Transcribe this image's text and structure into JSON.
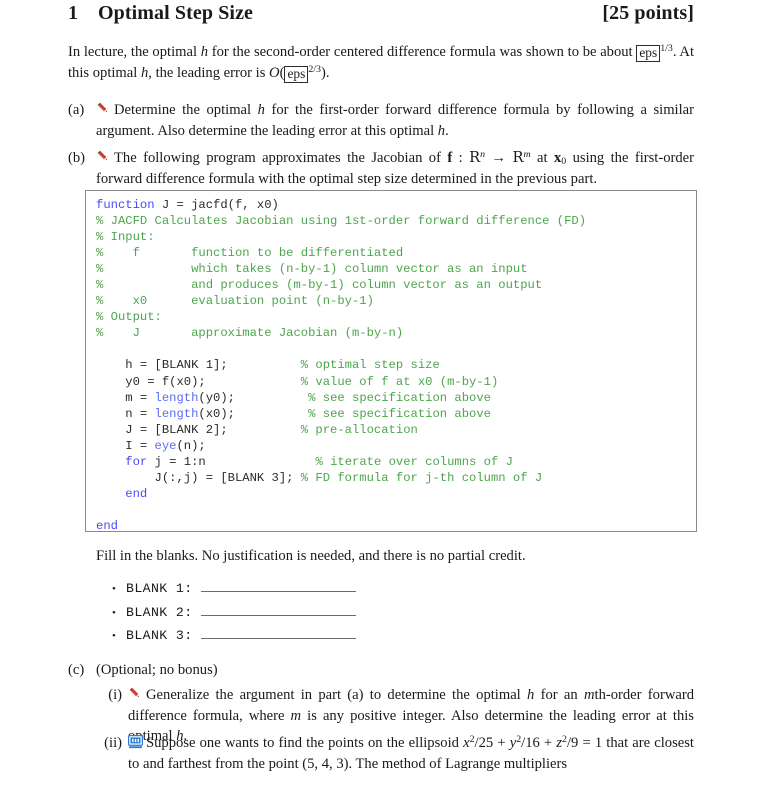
{
  "heading": {
    "number": "1",
    "title": "Optimal Step Size",
    "points": "[25 points]"
  },
  "intro": {
    "text_1": "In lecture, the optimal ",
    "var_h": "h",
    "text_2": " for the second-order centered difference formula was shown to be about ",
    "eps_1": "eps",
    "exp_1": "1/3",
    "text_3": ". At this optimal ",
    "var_h2": "h",
    "text_4": ", the leading error is ",
    "bigO": "O",
    "eps_2": "eps",
    "exp_2": "2/3",
    "text_5": ")."
  },
  "parts": {
    "a": {
      "label": "(a)",
      "icon": "pencil-icon",
      "text_1": "Determine the optimal ",
      "var_h": "h",
      "text_2": " for the first-order forward difference formula by following a similar argument. Also determine the leading error at this optimal ",
      "var_h2": "h",
      "text_3": "."
    },
    "b": {
      "label": "(b)",
      "icon": "pencil-icon",
      "text_1": "The following program approximates the Jacobian of ",
      "f_bold": "f",
      "colon": " : ",
      "Rn": "R",
      "Rn_sup": "n",
      "arrow": " → ",
      "Rm": "R",
      "Rm_sup": "m",
      "text_2": " at ",
      "x_bold": "x",
      "x_sub": "0",
      "text_3": " using the first-order forward difference formula with the optimal step size determined in the previous part."
    },
    "c": {
      "label": "(c)",
      "text": "(Optional; no bonus)",
      "sub_i": {
        "label": "(i)",
        "icon": "pencil-icon",
        "text_1": "Generalize the argument in part (a) to determine the optimal ",
        "var_h": "h",
        "text_2": " for an ",
        "var_m": "m",
        "text_3": "th-order forward difference formula, where ",
        "var_m2": "m",
        "text_4": " is any positive integer. Also determine the leading error at this optimal ",
        "var_h2": "h",
        "text_5": "."
      },
      "sub_ii": {
        "label": "(ii)",
        "icon": "monitor-icon",
        "text_1": "Suppose one wants to find the points on the ellipsoid ",
        "eq_x": "x",
        "eq_x_sup": "2",
        "eq_x_den": "/25 + ",
        "eq_y": "y",
        "eq_y_sup": "2",
        "eq_y_den": "/16 + ",
        "eq_z": "z",
        "eq_z_sup": "2",
        "eq_z_den": "/9 = 1",
        "text_2": " that are closest to and farthest from the point (5, 4, 3). The method of Lagrange multipliers"
      }
    }
  },
  "code": {
    "lines": [
      [
        {
          "t": "function",
          "c": "kw"
        },
        {
          "t": " J = ",
          "c": "pl"
        },
        {
          "t": "jacfd",
          "c": "pl"
        },
        {
          "t": "(f, x0)",
          "c": "pl"
        }
      ],
      [
        {
          "t": "% JACFD Calculates Jacobian using 1st-order forward difference (FD)",
          "c": "cm"
        }
      ],
      [
        {
          "t": "% Input:",
          "c": "cm"
        }
      ],
      [
        {
          "t": "%    f       function to be differentiated",
          "c": "cm"
        }
      ],
      [
        {
          "t": "%            which takes (n-by-1) column vector as an input",
          "c": "cm"
        }
      ],
      [
        {
          "t": "%            and produces (m-by-1) column vector as an output",
          "c": "cm"
        }
      ],
      [
        {
          "t": "%    x0      evaluation point (n-by-1)",
          "c": "cm"
        }
      ],
      [
        {
          "t": "% Output:",
          "c": "cm"
        }
      ],
      [
        {
          "t": "%    J       approximate Jacobian (m-by-n)",
          "c": "cm"
        }
      ],
      [
        {
          "t": "",
          "c": "pl"
        }
      ],
      [
        {
          "t": "    h = [BLANK 1];          ",
          "c": "pl"
        },
        {
          "t": "% optimal step size",
          "c": "cm"
        }
      ],
      [
        {
          "t": "    y0 = f(x0);             ",
          "c": "pl"
        },
        {
          "t": "% value of f at x0 (m-by-1)",
          "c": "cm"
        }
      ],
      [
        {
          "t": "    m = ",
          "c": "pl"
        },
        {
          "t": "length",
          "c": "fn"
        },
        {
          "t": "(y0);          ",
          "c": "pl"
        },
        {
          "t": "% see specification above",
          "c": "cm"
        }
      ],
      [
        {
          "t": "    n = ",
          "c": "pl"
        },
        {
          "t": "length",
          "c": "fn"
        },
        {
          "t": "(x0);          ",
          "c": "pl"
        },
        {
          "t": "% see specification above",
          "c": "cm"
        }
      ],
      [
        {
          "t": "    J = [BLANK 2];          ",
          "c": "pl"
        },
        {
          "t": "% pre-allocation",
          "c": "cm"
        }
      ],
      [
        {
          "t": "    I = ",
          "c": "pl"
        },
        {
          "t": "eye",
          "c": "fn"
        },
        {
          "t": "(n);",
          "c": "pl"
        }
      ],
      [
        {
          "t": "    ",
          "c": "pl"
        },
        {
          "t": "for",
          "c": "kw"
        },
        {
          "t": " j = 1:n               ",
          "c": "pl"
        },
        {
          "t": "% iterate over columns of J",
          "c": "cm"
        }
      ],
      [
        {
          "t": "        J(:,j) = [BLANK 3]; ",
          "c": "pl"
        },
        {
          "t": "% FD formula for j-th column of J",
          "c": "cm"
        }
      ],
      [
        {
          "t": "    ",
          "c": "pl"
        },
        {
          "t": "end",
          "c": "kw"
        }
      ],
      [
        {
          "t": "",
          "c": "pl"
        }
      ],
      [
        {
          "t": "end",
          "c": "kw"
        }
      ]
    ]
  },
  "fillin": {
    "instruction": "Fill in the blanks. No justification is needed, and there is no partial credit.",
    "blanks": [
      {
        "bullet": "•",
        "label": "BLANK 1:"
      },
      {
        "bullet": "•",
        "label": "BLANK 2:"
      },
      {
        "bullet": "•",
        "label": "BLANK 3:"
      }
    ]
  },
  "colors": {
    "keyword": "#4a4af0",
    "comment": "#4ca64c",
    "pencil": "#c0392b",
    "monitor": "#2d7dd2",
    "code_border": "#8a8a8a",
    "rule": "#6b6b6b"
  }
}
